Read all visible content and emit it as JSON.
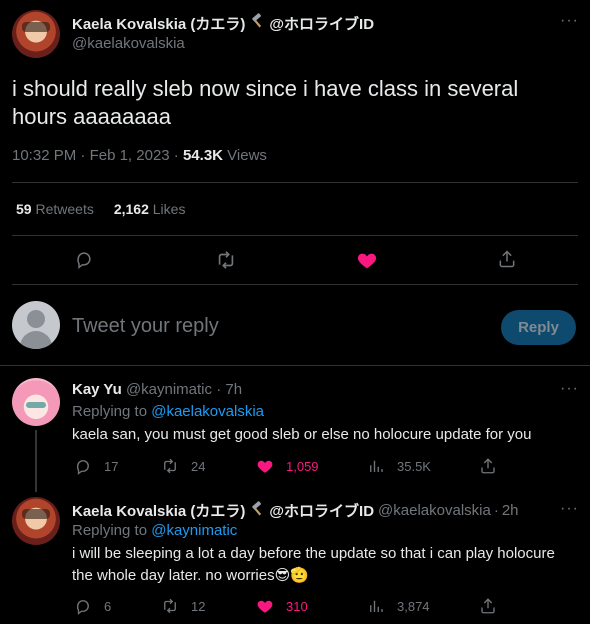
{
  "main_tweet": {
    "author_name": "Kaela Kovalskia (カエラ)",
    "author_name_suffix": "@ホロライブID",
    "handle": "@kaelakovalskia",
    "text": "i should really sleb now since i have class in several hours aaaaaaaa",
    "time": "10:32 PM",
    "date": "Feb 1, 2023",
    "views_count": "54.3K",
    "views_label": "Views",
    "retweets_count": "59",
    "retweets_label": "Retweets",
    "likes_count": "2,162",
    "likes_label": "Likes",
    "liked": true
  },
  "reply_box": {
    "placeholder": "Tweet your reply",
    "button_label": "Reply"
  },
  "replies": [
    {
      "author_name": "Kay Yu",
      "handle": "@kaynimatic",
      "time_ago": "7h",
      "replying_to_label": "Replying to",
      "replying_to_handle": "@kaelakovalskia",
      "text": "kaela san, you must get good sleb or else no holocure update for you",
      "replies": "17",
      "retweets": "24",
      "likes": "1,059",
      "views": "35.5K"
    },
    {
      "author_name": "Kaela Kovalskia (カエラ)",
      "author_name_suffix": "@ホロライブID",
      "handle": "@kaelakovalskia",
      "time_ago": "2h",
      "replying_to_label": "Replying to",
      "replying_to_handle": "@kaynimatic",
      "text_line1": "i will be sleeping a lot a day before the update so that i can play holocure",
      "text_line2": "the whole day later. no worries",
      "emoji": "😎🫡",
      "replies": "6",
      "retweets": "12",
      "likes": "310",
      "views": "3,874"
    }
  ],
  "colors": {
    "background": "#000000",
    "text": "#e7e9ea",
    "muted": "#71767b",
    "link": "#1d9bf0",
    "like": "#f91880",
    "divider": "#2f3336",
    "reply_button": "#0e4a6e"
  },
  "icons": [
    "hammer-icon",
    "more-icon",
    "reply-icon",
    "retweet-icon",
    "like-icon",
    "share-icon",
    "views-icon"
  ]
}
